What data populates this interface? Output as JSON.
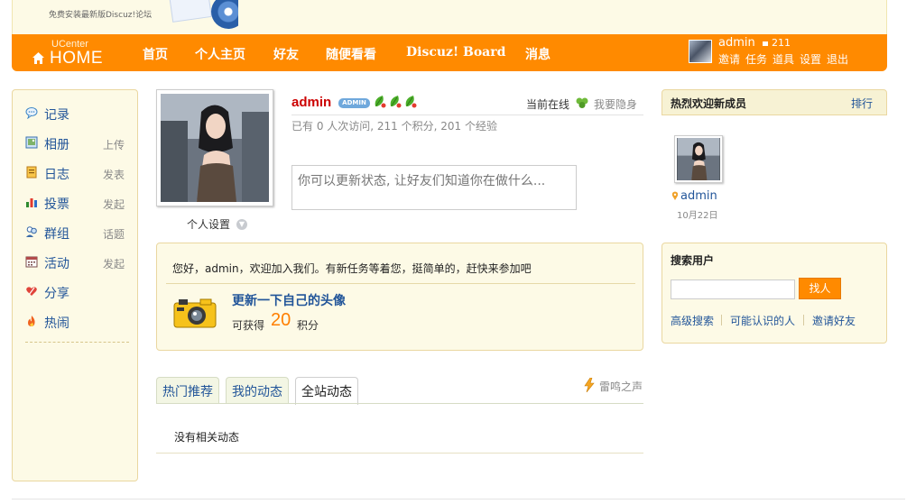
{
  "banner": {
    "promo_text": "免费安装最新版Discuz!论坛"
  },
  "nav": {
    "ucenter_label": "UCenter",
    "home_label": "HOME",
    "links": [
      "首页",
      "个人主页",
      "好友",
      "随便看看",
      "Discuz! Board",
      "消息"
    ],
    "username": "admin",
    "credits": "211",
    "user_menu": [
      "邀请",
      "任务",
      "道具",
      "设置",
      "退出"
    ]
  },
  "sidebar": {
    "items": [
      {
        "label": "记录",
        "action": "",
        "icon": "speech-bubble-icon"
      },
      {
        "label": "相册",
        "action": "上传",
        "icon": "photo-album-icon"
      },
      {
        "label": "日志",
        "action": "发表",
        "icon": "blog-notebook-icon"
      },
      {
        "label": "投票",
        "action": "发起",
        "icon": "poll-bar-chart-icon"
      },
      {
        "label": "群组",
        "action": "话题",
        "icon": "group-people-icon"
      },
      {
        "label": "活动",
        "action": "发起",
        "icon": "calendar-icon"
      },
      {
        "label": "分享",
        "action": "",
        "icon": "share-heart-icon"
      },
      {
        "label": "热闹",
        "action": "",
        "icon": "flame-icon"
      }
    ]
  },
  "profile": {
    "name": "admin",
    "badge": "ADMIN",
    "settings_label": "个人设置",
    "online_status": "当前在线",
    "hide_label": "我要隐身",
    "stats": "已有  0 人次访问, 211 个积分, 201 个经验",
    "status_placeholder": "你可以更新状态, 让好友们知道你在做什么..."
  },
  "task": {
    "welcome": "您好，admin，欢迎加入我们。有新任务等着您，挺简单的，赶快来参加吧",
    "title": "更新一下自己的头像",
    "reward_label": "可获得",
    "reward_points": "20",
    "reward_unit": "积分"
  },
  "tabs": {
    "items": [
      "热门推荐",
      "我的动态",
      "全站动态"
    ],
    "active": "全站动态",
    "thunder_link": "雷鸣之声",
    "empty_message": "没有相关动态"
  },
  "new_members": {
    "title": "热烈欢迎新成员",
    "rank_link": "排行",
    "member_name": "admin",
    "member_date": "10月22日"
  },
  "search": {
    "title": "搜索用户",
    "input_value": "",
    "button_label": "找人",
    "links": [
      "高级搜索",
      "可能认识的人",
      "邀请好友"
    ]
  },
  "colors": {
    "nav_orange": "#ff8a00",
    "panel_cream": "#fdfae6",
    "panel_border": "#ead7a0",
    "link_blue": "#225599",
    "name_red": "#cc0000"
  }
}
